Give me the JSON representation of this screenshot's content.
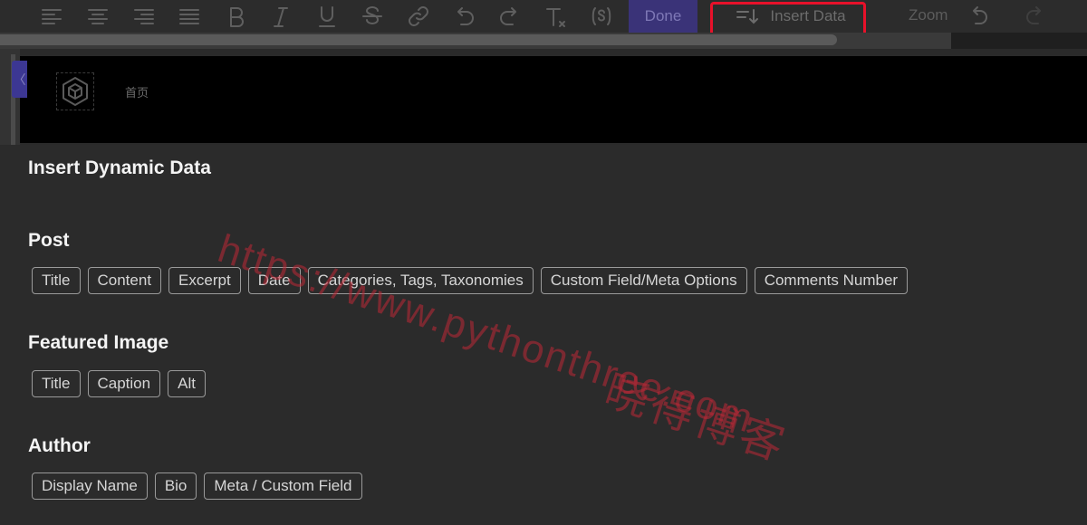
{
  "toolbar": {
    "done_label": "Done",
    "insert_data_label": "Insert Data",
    "zoom_label": "Zoom",
    "icons": [
      "align-left-icon",
      "align-center-icon",
      "align-right-icon",
      "align-justify-icon",
      "bold-icon",
      "italic-icon",
      "underline-icon",
      "strikethrough-icon",
      "link-icon",
      "undo-icon",
      "redo-icon",
      "clear-format-icon",
      "shortcode-icon"
    ],
    "highlight_color": "#e8112a"
  },
  "header": {
    "home_link": "首页"
  },
  "panel": {
    "title": "Insert Dynamic Data",
    "sections": [
      {
        "title": "Post",
        "items": [
          "Title",
          "Content",
          "Excerpt",
          "Date",
          "Categories, Tags, Taxonomies",
          "Custom Field/Meta Options",
          "Comments Number"
        ]
      },
      {
        "title": "Featured Image",
        "items": [
          "Title",
          "Caption",
          "Alt"
        ]
      },
      {
        "title": "Author",
        "items": [
          "Display Name",
          "Bio",
          "Meta / Custom Field"
        ]
      }
    ]
  },
  "watermark": {
    "url": "https://www.pythonthree.com",
    "text": "晓得博客"
  }
}
